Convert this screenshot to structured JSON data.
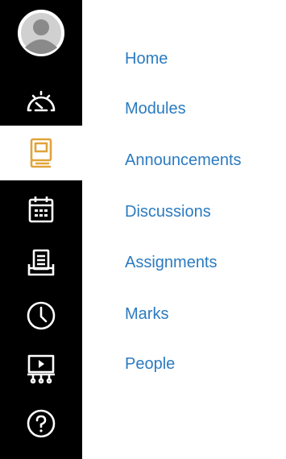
{
  "colors": {
    "nav_background": "#000000",
    "nav_icon": "#ffffff",
    "active_item_background": "#ffffff",
    "active_icon": "#e0a33a",
    "link": "#2b7bc0"
  },
  "global_nav": {
    "items": [
      {
        "name": "account",
        "icon": "user-avatar-icon",
        "active": false
      },
      {
        "name": "dashboard",
        "icon": "speedometer-icon",
        "active": false
      },
      {
        "name": "courses",
        "icon": "book-icon",
        "active": true
      },
      {
        "name": "calendar",
        "icon": "calendar-icon",
        "active": false
      },
      {
        "name": "inbox",
        "icon": "inbox-icon",
        "active": false
      },
      {
        "name": "history",
        "icon": "clock-icon",
        "active": false
      },
      {
        "name": "studio",
        "icon": "presentation-icon",
        "active": false
      },
      {
        "name": "help",
        "icon": "help-icon",
        "active": false
      }
    ]
  },
  "course_nav": {
    "links": [
      "Home",
      "Modules",
      "Announcements",
      "Discussions",
      "Assignments",
      "Marks",
      "People"
    ]
  }
}
